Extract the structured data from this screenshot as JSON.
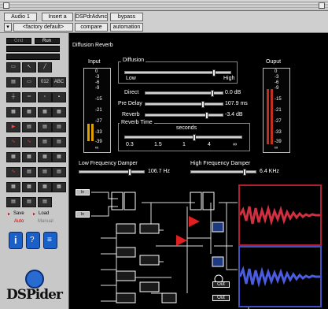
{
  "toolbar": {
    "track": "Audio 1",
    "insert": "Insert a",
    "plugin": "DSPdrAdvnc",
    "bypass": "bypass",
    "preset": "<factory default>",
    "compare": "compare",
    "automation": "automation"
  },
  "palette": {
    "grid_label": "Grid",
    "run_label": "Run",
    "save_label": "Save",
    "load_label": "Load",
    "auto_label": "Auto",
    "manual_label": "Manual",
    "logo_text": "DSPider",
    "colors": {
      "bg": "#c8c8c8",
      "blue": "#1b60c8",
      "red": "#c00000"
    }
  },
  "panel": {
    "title": "Diffusion Reverb",
    "input_label": "Input",
    "output_label": "Ouput",
    "meter_ticks": [
      "0",
      "-3",
      "-6",
      "-9",
      "-15",
      "-21",
      "-27",
      "-33",
      "-39",
      "∞"
    ],
    "diffusion": {
      "label": "Diffusion",
      "low": "Low",
      "high": "High",
      "level": 0.85
    },
    "direct": {
      "label": "Direct",
      "value": "0.0 dB",
      "level": 0.88
    },
    "predelay": {
      "label": "Pre Delay",
      "value": "107.9 ms",
      "level": 0.76
    },
    "reverb": {
      "label": "Reverb",
      "value": "-3.4 dB",
      "level": 0.81
    },
    "reverb_time": {
      "label": "Reverb Time",
      "unit": "seconds",
      "scale": [
        "0.3",
        "1.5",
        "1",
        "4",
        "∞"
      ],
      "level": 0.6
    },
    "lf_damper": {
      "label": "Low Frequency Damper",
      "value": "106.7 Hz",
      "level": 0.8
    },
    "hf_damper": {
      "label": "High Frequency Damper",
      "value": "6.4 KHz",
      "level": 0.85
    },
    "in_buttons": [
      "In",
      "In"
    ],
    "out_buttons": [
      "Out",
      "Out"
    ],
    "scope_colors": {
      "top": "#b02030",
      "bottom": "#4050c0"
    }
  }
}
